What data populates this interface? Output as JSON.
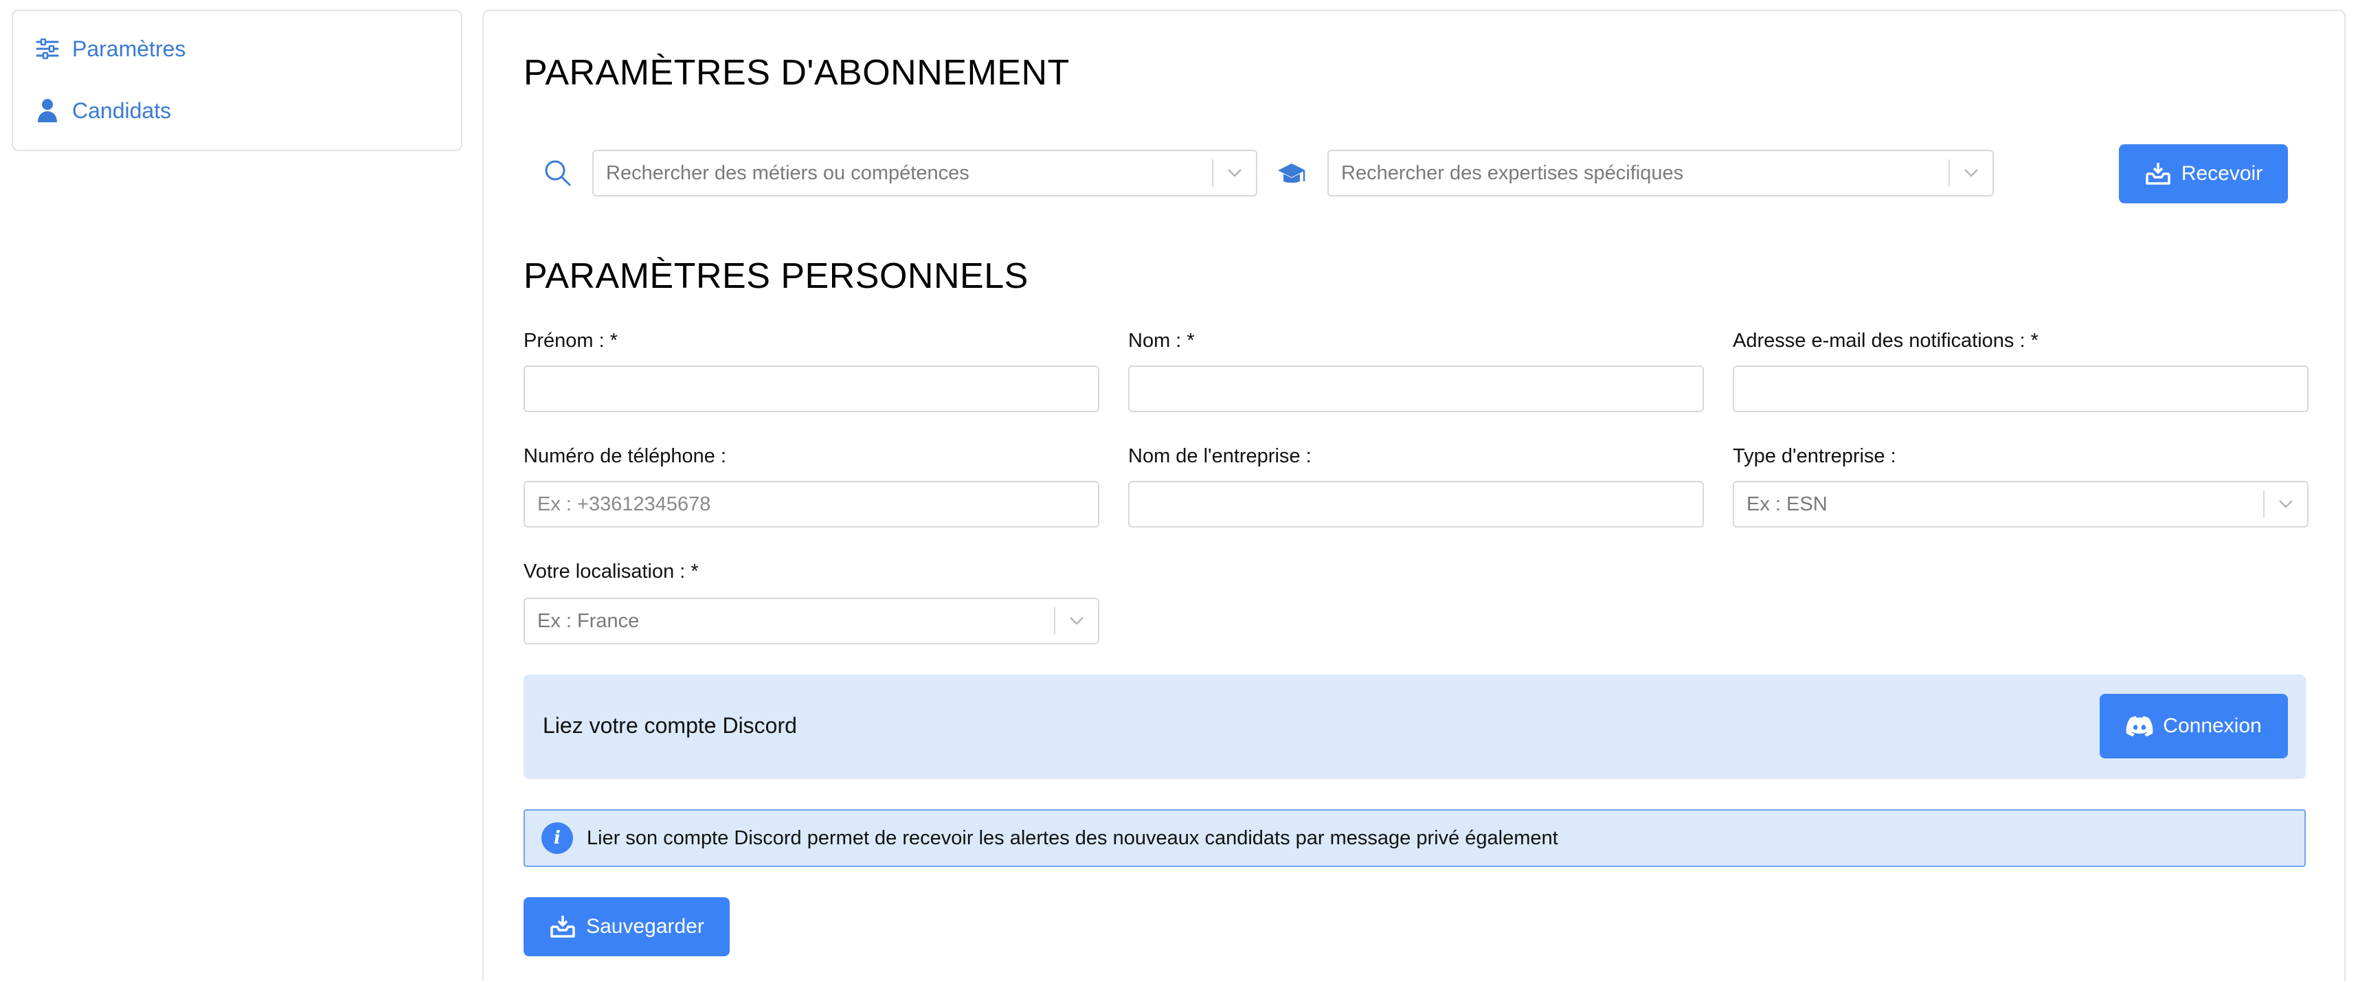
{
  "sidebar": {
    "items": [
      {
        "label": "Paramètres",
        "icon": "sliders-icon"
      },
      {
        "label": "Candidats",
        "icon": "user-icon"
      }
    ]
  },
  "subscription": {
    "title": "PARAMÈTRES D'ABONNEMENT",
    "jobs_placeholder": "Rechercher des métiers ou compétences",
    "expertise_placeholder": "Rechercher des expertises spécifiques",
    "receive_label": "Recevoir"
  },
  "personal": {
    "title": "PARAMÈTRES PERSONNELS",
    "first_name_label": "Prénom : *",
    "last_name_label": "Nom : *",
    "email_label": "Adresse e-mail des notifications : *",
    "phone_label": "Numéro de téléphone :",
    "phone_placeholder": "Ex : +33612345678",
    "company_name_label": "Nom de l'entreprise :",
    "company_type_label": "Type d'entreprise :",
    "company_type_placeholder": "Ex : ESN",
    "location_label": "Votre localisation : *",
    "location_placeholder": "Ex : France"
  },
  "discord": {
    "label": "Liez votre compte Discord",
    "connect_label": "Connexion",
    "info_text": "Lier son compte Discord permet de recevoir les alertes des nouveaux candidats par message privé également"
  },
  "save_label": "Sauvegarder",
  "colors": {
    "accent": "#3b82f6",
    "link": "#3a7bd5",
    "panel_bg": "#dce9fb"
  }
}
